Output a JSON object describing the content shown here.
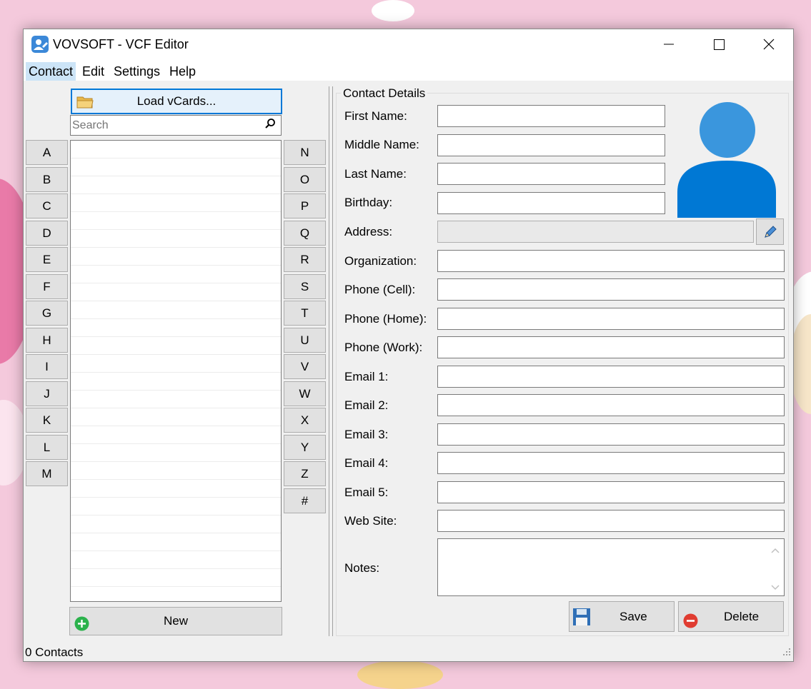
{
  "window": {
    "title": "VOVSOFT - VCF Editor"
  },
  "menu": {
    "items": [
      "Contact",
      "Edit",
      "Settings",
      "Help"
    ]
  },
  "left_panel": {
    "load_button_label": "Load vCards...",
    "search_placeholder": "Search",
    "letters_left": [
      "A",
      "B",
      "C",
      "D",
      "E",
      "F",
      "G",
      "H",
      "I",
      "J",
      "K",
      "L",
      "M"
    ],
    "letters_right": [
      "N",
      "O",
      "P",
      "Q",
      "R",
      "S",
      "T",
      "U",
      "V",
      "W",
      "X",
      "Y",
      "Z",
      "#"
    ],
    "new_button_label": "New"
  },
  "details": {
    "group_title": "Contact Details",
    "labels": {
      "first_name": "First Name:",
      "middle_name": "Middle Name:",
      "last_name": "Last Name:",
      "birthday": "Birthday:",
      "address": "Address:",
      "organization": "Organization:",
      "phone_cell": "Phone (Cell):",
      "phone_home": "Phone (Home):",
      "phone_work": "Phone (Work):",
      "email1": "Email 1:",
      "email2": "Email 2:",
      "email3": "Email 3:",
      "email4": "Email 4:",
      "email5": "Email 5:",
      "website": "Web Site:",
      "notes": "Notes:"
    },
    "save_label": "Save",
    "delete_label": "Delete"
  },
  "status": {
    "text": "0 Contacts"
  },
  "icons": {
    "app": "contact-card-icon",
    "folder": "folder-icon",
    "search": "search-icon",
    "avatar": "person-avatar-icon",
    "edit": "pencil-icon",
    "add": "plus-circle-icon",
    "save": "floppy-disk-icon",
    "delete": "minus-circle-icon"
  },
  "colors": {
    "accent": "#0078d7",
    "avatar_head": "#3a96dd",
    "avatar_body": "#0078d4",
    "add_green": "#2bb24c",
    "delete_red": "#e03c31"
  }
}
